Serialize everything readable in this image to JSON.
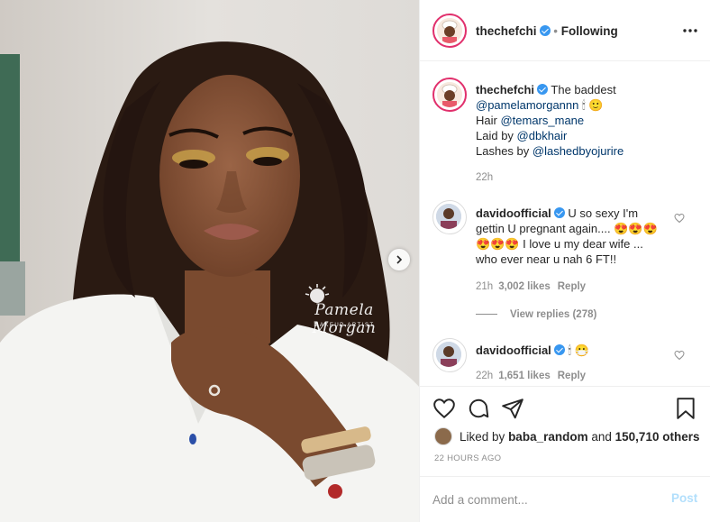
{
  "post": {
    "username": "thechefchi",
    "follow_state": "Following",
    "more_icon": "more-horizontal-icon",
    "next_icon": "chevron-right-icon"
  },
  "photo": {
    "watermark_name": "Pamela Morgan",
    "watermark_subtitle": "MAKEUP ARTIST"
  },
  "caption": {
    "username": "thechefchi",
    "lines": [
      {
        "prefix": "The baddest",
        "link": "",
        "suffix": ""
      },
      {
        "prefix": "",
        "link": "@pamelamorgannn",
        "suffix": "🕯 🙂"
      },
      {
        "prefix": "Hair ",
        "link": "@temars_mane",
        "suffix": ""
      },
      {
        "prefix": "Laid by ",
        "link": "@dbkhair",
        "suffix": ""
      },
      {
        "prefix": "Lashes by ",
        "link": "@lashedbyojurire",
        "suffix": ""
      }
    ],
    "time": "22h"
  },
  "comments": [
    {
      "username": "davidoofficial",
      "lines": [
        "U so sexy I'm",
        "gettin U pregnant again.... 😍😍😍",
        "😍😍😍 I love u my dear wife ...",
        "who ever near u nah 6 FT!!"
      ],
      "time": "21h",
      "likes": "3,002 likes",
      "reply": "Reply",
      "view_replies": "View replies (278)"
    },
    {
      "username": "davidoofficial",
      "text": "🕯 😷",
      "time": "22h",
      "likes": "1,651 likes",
      "reply": "Reply"
    }
  ],
  "actions": {
    "like_icon": "heart-icon",
    "comment_icon": "comment-icon",
    "share_icon": "share-icon",
    "save_icon": "bookmark-icon"
  },
  "likes": {
    "prefix": "Liked by",
    "user": "baba_random",
    "and": "and",
    "count": "150,710 others"
  },
  "posted": "22 HOURS AGO",
  "comment_box": {
    "placeholder": "Add a comment...",
    "post_label": "Post"
  },
  "colors": {
    "verified": "#3897f0",
    "story_ring": "#e1306c",
    "link": "#00376b",
    "post_disabled": "#b2dffc",
    "meta": "#8e8e8e"
  }
}
